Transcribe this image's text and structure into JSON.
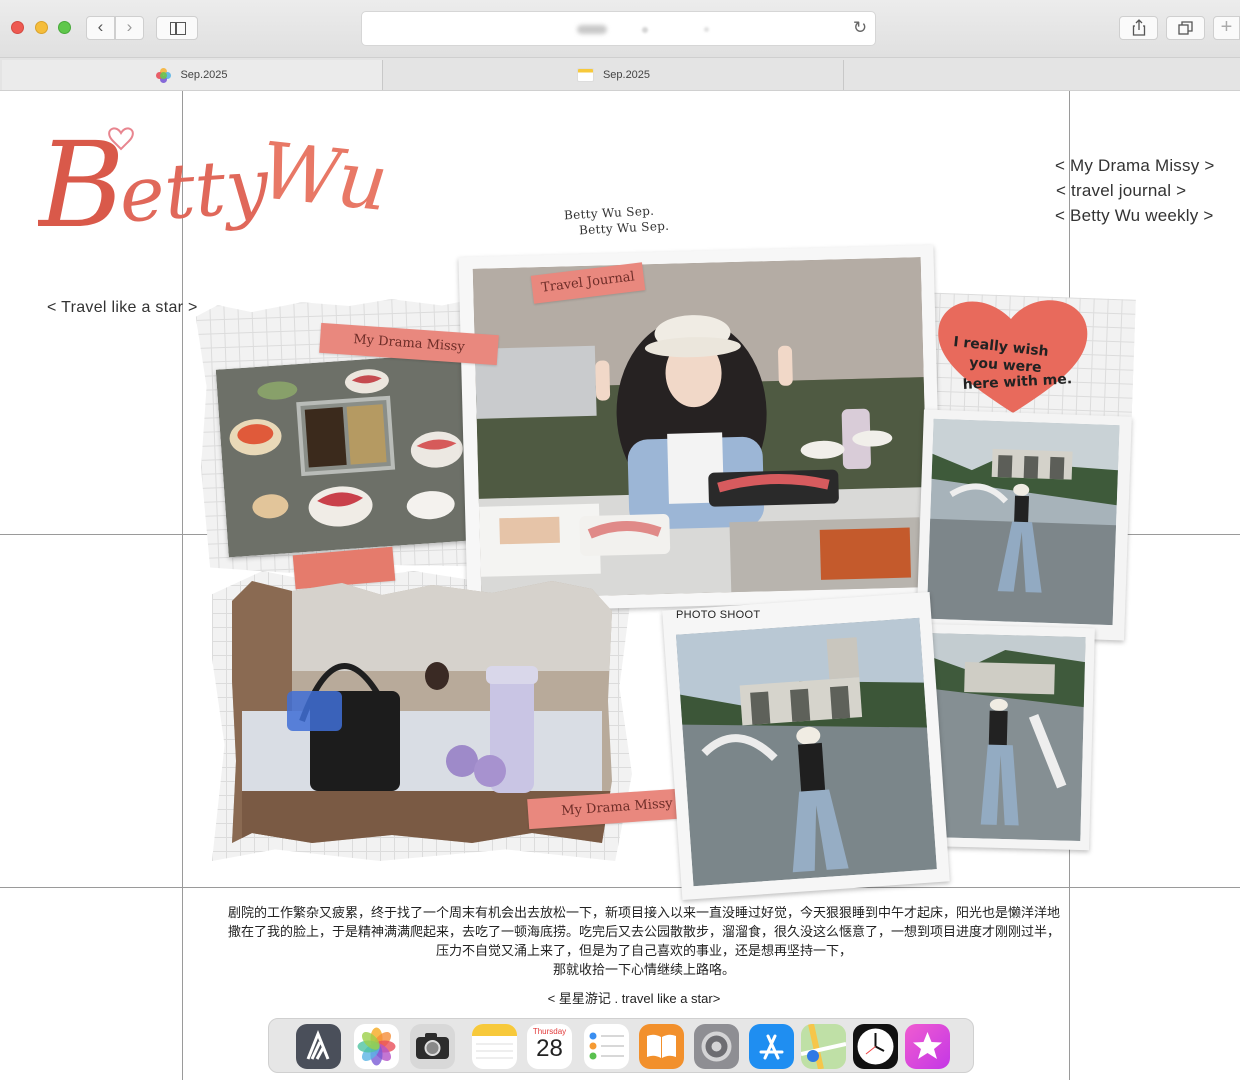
{
  "browser": {
    "tabs": [
      {
        "label": "Sep.2025",
        "icon": "photos-icon"
      },
      {
        "label": "Sep.2025",
        "icon": "notes-icon"
      }
    ]
  },
  "page": {
    "brand": {
      "first": "B",
      "rest": "etty",
      "last": "Wu"
    },
    "menu": [
      "< My Drama Missy >",
      "< travel journal >",
      "< Betty Wu weekly >"
    ],
    "tagline": "< Travel like a star >",
    "stamp_lines": [
      "Betty Wu Sep.",
      "Betty Wu Sep."
    ],
    "tapes": {
      "travel_journal": "Travel Journal",
      "drama_top": "My Drama Missy",
      "drama_bottom": "My Drama Missy"
    },
    "heart_note": [
      "I really wish",
      "you were",
      "here with me."
    ],
    "photo_shoot": "PHOTO SHOOT",
    "article": [
      "剧院的工作繁杂又疲累，终于找了一个周末有机会出去放松一下，新项目接入以来一直没睡过好觉，今天狠狠睡到中午才起床，阳光也是懒洋洋地",
      "撒在了我的脸上，于是精神满满爬起来，去吃了一顿海底捞。吃完后又去公园散散步，溜溜食，很久没这么惬意了，一想到项目进度才刚刚过半，",
      "压力不自觉又涌上来了，但是为了自己喜欢的事业，还是想再坚持一下，",
      "那就收拾一下心情继续上路咯。"
    ],
    "footer_link": "< 星星游记 . travel like a star>"
  },
  "dock": {
    "calendar_day": "Thursday",
    "calendar_date": "28",
    "apps": [
      "altimeter-icon",
      "photos-icon",
      "camera-icon",
      "notes-icon",
      "calendar-icon",
      "reminders-icon",
      "books-icon",
      "settings-icon",
      "app-store-icon",
      "maps-icon",
      "clock-icon",
      "itunes-store-icon"
    ]
  },
  "colors": {
    "brand_red": "#d9594a",
    "tape_pink": "#e9887e",
    "heart": "#e86a5c"
  }
}
